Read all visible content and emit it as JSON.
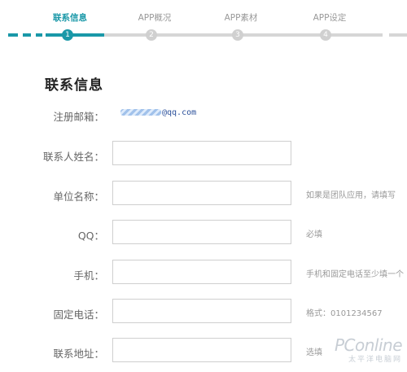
{
  "steps": [
    {
      "label": "联系信息",
      "number": "1",
      "active": true
    },
    {
      "label": "APP概况",
      "number": "2",
      "active": false
    },
    {
      "label": "APP素材",
      "number": "3",
      "active": false
    },
    {
      "label": "APP设定",
      "number": "4",
      "active": false
    }
  ],
  "section_title": "联系信息",
  "email": {
    "label": "注册邮箱：",
    "value_visible": "@qq.com"
  },
  "fields": [
    {
      "label": "联系人姓名：",
      "value": "",
      "hint": ""
    },
    {
      "label": "单位名称：",
      "value": "",
      "hint": "如果是团队应用，请填写"
    },
    {
      "label": "QQ：",
      "value": "",
      "hint": "必填"
    },
    {
      "label": "手机：",
      "value": "",
      "hint": "手机和固定电话至少填一个"
    },
    {
      "label": "固定电话：",
      "value": "",
      "hint": "格式：0101234567"
    },
    {
      "label": "联系地址：",
      "value": "",
      "hint": "选填"
    }
  ],
  "watermark": {
    "main": "PConline",
    "sub": "太平洋电脑网"
  },
  "colors": {
    "accent": "#1a98a8",
    "inactive": "#d0d0d0"
  }
}
